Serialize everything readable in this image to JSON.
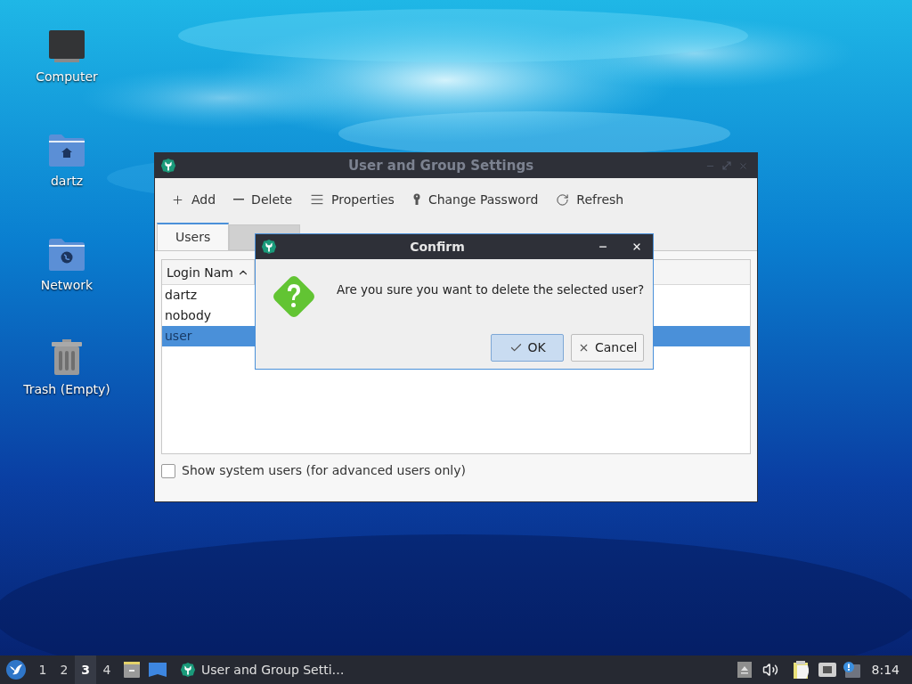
{
  "desktop_icons": [
    {
      "label": "Computer",
      "kind": "computer"
    },
    {
      "label": "dartz",
      "kind": "home"
    },
    {
      "label": "Network",
      "kind": "network"
    },
    {
      "label": "Trash (Empty)",
      "kind": "trash"
    }
  ],
  "window": {
    "title": "User and Group Settings",
    "active": false,
    "toolbar": [
      {
        "label": "Add",
        "kind": "add"
      },
      {
        "label": "Delete",
        "kind": "delete"
      },
      {
        "label": "Properties",
        "kind": "properties"
      },
      {
        "label": "Change Password",
        "kind": "password"
      },
      {
        "label": "Refresh",
        "kind": "refresh"
      }
    ],
    "tabs": [
      {
        "label": "Users",
        "selected": true
      },
      {
        "selected": false
      }
    ],
    "table": {
      "columns": [
        "Login Nam"
      ],
      "rows": [
        {
          "login": "dartz",
          "selected": false
        },
        {
          "login": "nobody",
          "selected": false
        },
        {
          "login": "user",
          "selected": true
        }
      ]
    },
    "show_system_users": {
      "label": "Show system users (for advanced users only)",
      "checked": false
    }
  },
  "dialog": {
    "title": "Confirm",
    "message": "Are you sure you want to delete the selected user?",
    "buttons": [
      {
        "label": "OK",
        "kind": "ok",
        "default": true
      },
      {
        "label": "Cancel",
        "kind": "cancel",
        "default": false
      }
    ]
  },
  "taskbar": {
    "workspaces": [
      {
        "label": "1",
        "selected": false
      },
      {
        "label": "2",
        "selected": false
      },
      {
        "label": "3",
        "selected": true
      },
      {
        "label": "4",
        "selected": false
      }
    ],
    "tasks": [
      {
        "label": "User and Group Setti…"
      }
    ],
    "clock": "8:14"
  }
}
